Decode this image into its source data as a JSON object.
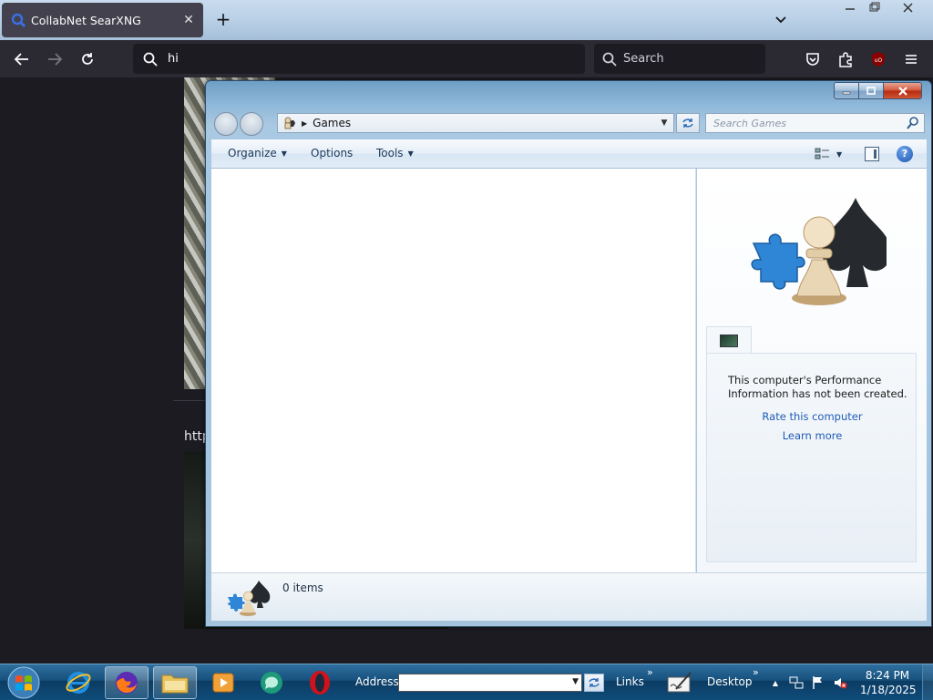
{
  "browser": {
    "tab_title": "CollabNet SearXNG",
    "url_text": "hi",
    "search_placeholder": "Search"
  },
  "page": {
    "partial_link": "http"
  },
  "explorer": {
    "address": "Games",
    "search_placeholder": "Search Games",
    "commands": {
      "organize": "Organize",
      "options": "Options",
      "tools": "Tools"
    },
    "performance_message": "This computer's Performance Information has not been created.",
    "rate_link": "Rate this computer",
    "learn_link": "Learn more",
    "item_count": "0 items"
  },
  "taskbar": {
    "address_label": "Address",
    "address_value": "",
    "links_label": "Links",
    "desktop_label": "Desktop",
    "time": "8:24 PM",
    "date": "1/18/2025"
  },
  "icons": {
    "favicon": "search-icon",
    "start": "windows-logo-icon",
    "ie": "internet-explorer-icon",
    "firefox": "firefox-icon",
    "explorer": "folder-icon",
    "media": "media-player-icon",
    "opera": "opera-icon"
  },
  "colors": {
    "browser_chrome": "#2b2a33",
    "link_blue": "#1f5bb5",
    "taskbar": "#17507c"
  }
}
